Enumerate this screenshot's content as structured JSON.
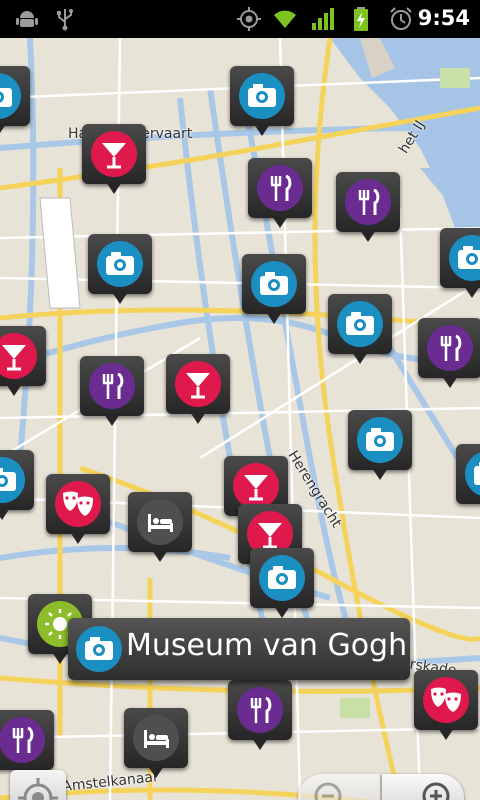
{
  "status_bar": {
    "time": "9:54",
    "icons": [
      "android-debug-icon",
      "usb-icon",
      "gps-icon",
      "wifi-icon",
      "signal-icon",
      "battery-charging-icon",
      "alarm-icon"
    ]
  },
  "map": {
    "street_labels": [
      "Haarlemmervaart",
      "het IJ",
      "Herengracht",
      "Stadhouderskade",
      "der Amstelkanaal"
    ],
    "selected_place": "Museum van Gogh"
  },
  "poi_categories": {
    "camera": {
      "color": "#1b8ec2",
      "icon": "camera-icon"
    },
    "cocktail": {
      "color": "#e0194d",
      "icon": "cocktail-glass-icon"
    },
    "restaurant": {
      "color": "#6a2c91",
      "icon": "fork-knife-icon"
    },
    "theatre": {
      "color": "#e0194d",
      "icon": "theatre-masks-icon"
    },
    "hotel": {
      "color": "#4f4f4f",
      "icon": "bed-icon"
    },
    "park": {
      "color": "#8cbd2a",
      "icon": "sun-icon"
    }
  },
  "controls": {
    "locate": "my-location-icon",
    "zoom_out": "zoom-out-icon",
    "zoom_in": "zoom-in-icon"
  }
}
